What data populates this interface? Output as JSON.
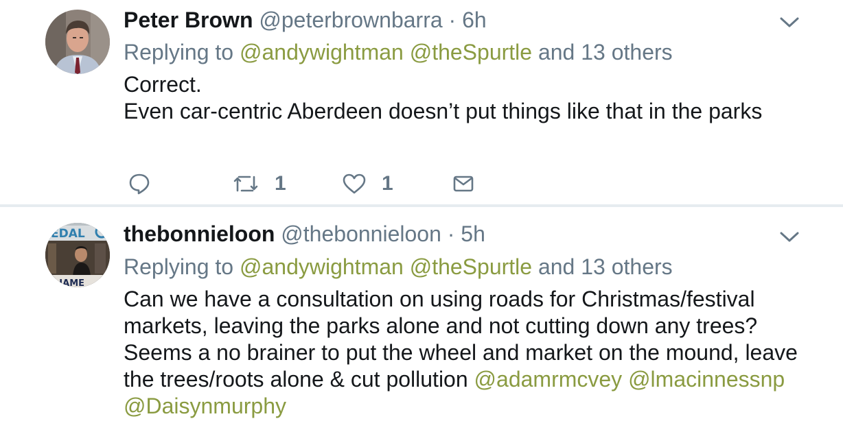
{
  "tweets": [
    {
      "display_name": "Peter Brown",
      "handle": "@peterbrownbarra",
      "separator": "·",
      "time": "6h",
      "replying_label": "Replying to",
      "reply_mentions": [
        "@andywightman",
        "@theSpurtle"
      ],
      "reply_others": "and 13 others",
      "body_lines": [
        "Correct.",
        "Even car-centric Aberdeen doesn’t put things like that in the parks"
      ],
      "retweet_count": "1",
      "like_count": "1",
      "icons": [
        "reply-icon",
        "retweet-icon",
        "like-icon",
        "direct-message-icon",
        "chevron-down-icon"
      ]
    },
    {
      "display_name": "thebonnieloon",
      "handle": "@thebonnieloon",
      "separator": "·",
      "time": "5h",
      "replying_label": "Replying to",
      "reply_mentions": [
        "@andywightman",
        "@theSpurtle"
      ],
      "reply_others": "and 13 others",
      "body_text": "Can we have a consultation on using roads for Christmas/festival markets,  leaving the parks alone and not cutting down any trees? Seems a no brainer to put the wheel and market on the mound, leave the trees/roots alone & cut pollution",
      "body_mentions": [
        "@adamrmcvey",
        "@lmacinnessnp",
        "@Daisynmurphy"
      ],
      "avatar_sign_text": "EDAL",
      "avatar_banner_text": "RLIAME"
    }
  ],
  "colors": {
    "text": "#14171a",
    "secondary": "#657786",
    "mention": "#8a9b41",
    "divider": "#e6ecf0"
  }
}
